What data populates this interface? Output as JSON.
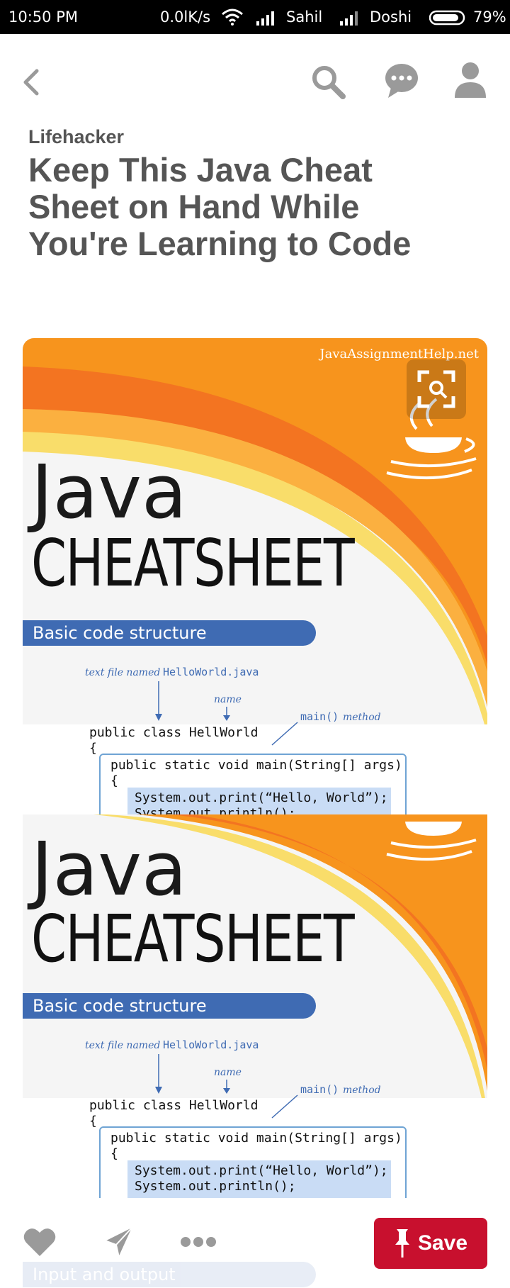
{
  "status_bar": {
    "time": "10:50 PM",
    "speed": "0.0lK/s",
    "carrier1": "Sahil",
    "carrier2": "Doshi",
    "battery": "79%"
  },
  "header": {
    "back_icon": "chevron-left-icon",
    "search_icon": "search-icon",
    "chat_icon": "chat-bubble-icon",
    "profile_icon": "person-icon"
  },
  "pin": {
    "source": "Lifehacker",
    "title": "Keep This Java Cheat Sheet on Hand While You're Learning to Code",
    "image": {
      "logo_text": "JavaAssignmentHelp.net",
      "java_word": "Java",
      "cheat_sheet": "CHEATSHEET",
      "section_band": "Basic code structure",
      "annotation_file_prefix": "text file named",
      "annotation_file_name": "HelloWorld.java",
      "annotation_name": "name",
      "annotation_main_method": "main()",
      "annotation_method": "method",
      "code_line1": "public class HellWorld",
      "code_brace": "{",
      "code_line2": "public static void main(String[] args)",
      "code_brace2": "{",
      "code_print1": "System.out.print(“Hello, World”);",
      "code_print2": "System.out.println();",
      "ghost_band": "Input and output"
    }
  },
  "actions": {
    "like_icon": "heart-icon",
    "send_icon": "send-icon",
    "more_icon": "more-dots-icon",
    "save_label": "Save",
    "save_icon": "pushpin-icon"
  },
  "colors": {
    "save_button": "#c8102e",
    "band_blue": "#3f6bb3",
    "text_gray": "#555555",
    "orange": "#f7941d"
  }
}
